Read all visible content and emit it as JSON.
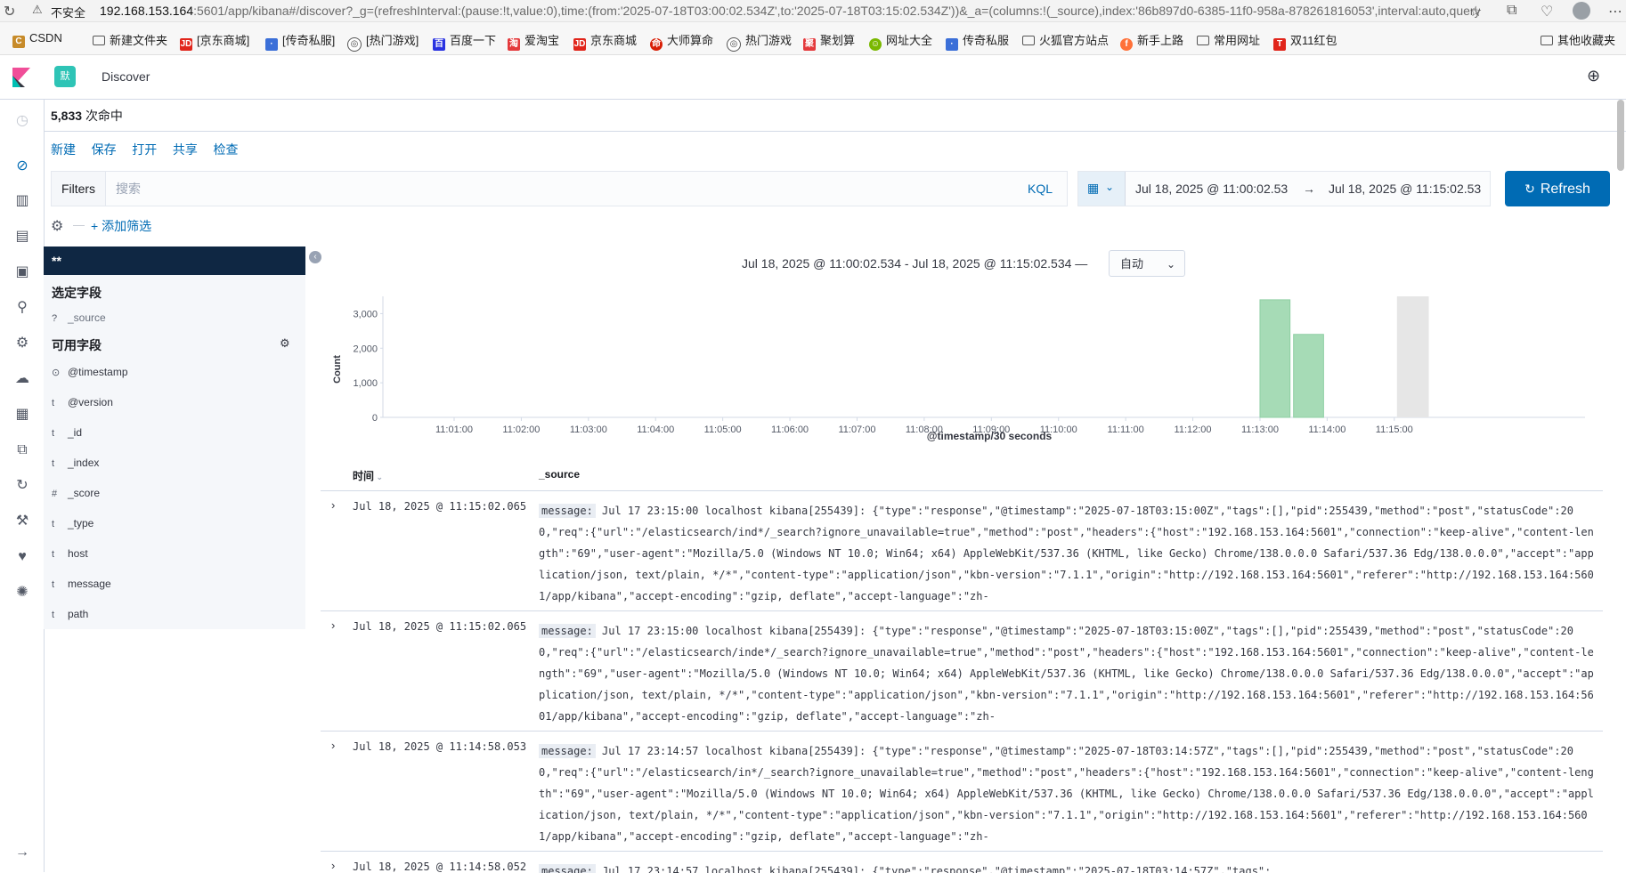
{
  "browser": {
    "security": "不安全",
    "url_host": "192.168.153.164",
    "url_rest": ":5601/app/kibana#/discover?_g=(refreshInterval:(pause:!t,value:0),time:(from:'2025-07-18T03:00:02.534Z',to:'2025-07-18T03:15:02.534Z'))&_a=(columns:!(_source),index:'86b897d0-6385-11f0-958a-878261816053',interval:auto,query:...",
    "bookmarks": [
      "CSDN",
      "新建文件夹",
      "[京东商城]",
      "[传奇私服]",
      "[热门游戏]",
      "百度一下",
      "爱淘宝",
      "京东商城",
      "大师算命",
      "热门游戏",
      "聚划算",
      "网址大全",
      "传奇私服",
      "火狐官方站点",
      "新手上路",
      "常用网址",
      "双11红包",
      "其他收藏夹"
    ]
  },
  "header": {
    "space_initial": "默",
    "app_title": "Discover"
  },
  "hits": {
    "count": "5,833",
    "suffix": "次命中"
  },
  "top_menu": [
    "新建",
    "保存",
    "打开",
    "共享",
    "检查"
  ],
  "search": {
    "filters_label": "Filters",
    "placeholder": "搜索",
    "kql_label": "KQL"
  },
  "time": {
    "start": "Jul 18, 2025 @ 11:00:02.53",
    "arrow": "→",
    "end": "Jul 18, 2025 @ 11:15:02.53",
    "refresh_label": "Refresh"
  },
  "filter_row": {
    "add_filter": "+ 添加筛选"
  },
  "sidebar": {
    "index_pattern": "**",
    "selected_title": "选定字段",
    "selected_fields": [
      {
        "type": "?",
        "name": "_source"
      }
    ],
    "available_title": "可用字段",
    "available_fields": [
      {
        "type": "⊙",
        "name": "@timestamp"
      },
      {
        "type": "t",
        "name": "@version"
      },
      {
        "type": "t",
        "name": "_id"
      },
      {
        "type": "t",
        "name": "_index"
      },
      {
        "type": "#",
        "name": "_score"
      },
      {
        "type": "t",
        "name": "_type"
      },
      {
        "type": "t",
        "name": "host"
      },
      {
        "type": "t",
        "name": "message"
      },
      {
        "type": "t",
        "name": "path"
      }
    ]
  },
  "chart_header": {
    "range": "Jul 18, 2025 @ 11:00:02.534 - Jul 18, 2025 @ 11:15:02.534 —",
    "interval": "自动"
  },
  "chart_data": {
    "type": "bar",
    "categories": [
      "11:01:00",
      "11:02:00",
      "11:03:00",
      "11:04:00",
      "11:05:00",
      "11:06:00",
      "11:07:00",
      "11:08:00",
      "11:09:00",
      "11:10:00",
      "11:11:00",
      "11:12:00",
      "11:13:00",
      "11:14:00",
      "11:15:00"
    ],
    "bars": [
      {
        "x": "11:13:00",
        "value": 3400
      },
      {
        "x": "11:13:30",
        "value": 2400
      }
    ],
    "partial_bucket": {
      "x": "11:15:00",
      "value": 3500
    },
    "yticks": [
      0,
      1000,
      2000,
      3000
    ],
    "ytick_labels": [
      "0",
      "1,000",
      "2,000",
      "3,000"
    ],
    "ylim": [
      0,
      3500
    ],
    "ylabel": "Count",
    "xlabel": "@timestamp/30 seconds",
    "bar_color": "#a6dbb6"
  },
  "table": {
    "col_time": "时间",
    "col_source": "_source",
    "rows": [
      {
        "time": "Jul 18, 2025 @ 11:15:02.065",
        "label": "message:",
        "text": " Jul 17 23:15:00 localhost kibana[255439]: {\"type\":\"response\",\"@timestamp\":\"2025-07-18T03:15:00Z\",\"tags\":[],\"pid\":255439,\"method\":\"post\",\"statusCode\":200,\"req\":{\"url\":\"/elasticsearch/ind*/_search?ignore_unavailable=true\",\"method\":\"post\",\"headers\":{\"host\":\"192.168.153.164:5601\",\"connection\":\"keep-alive\",\"content-length\":\"69\",\"user-agent\":\"Mozilla/5.0 (Windows NT 10.0; Win64; x64) AppleWebKit/537.36 (KHTML, like Gecko) Chrome/138.0.0.0 Safari/537.36 Edg/138.0.0.0\",\"accept\":\"application/json, text/plain, */*\",\"content-type\":\"application/json\",\"kbn-version\":\"7.1.1\",\"origin\":\"http://192.168.153.164:5601\",\"referer\":\"http://192.168.153.164:5601/app/kibana\",\"accept-encoding\":\"gzip, deflate\",\"accept-language\":\"zh-"
      },
      {
        "time": "Jul 18, 2025 @ 11:15:02.065",
        "label": "message:",
        "text": " Jul 17 23:15:00 localhost kibana[255439]: {\"type\":\"response\",\"@timestamp\":\"2025-07-18T03:15:00Z\",\"tags\":[],\"pid\":255439,\"method\":\"post\",\"statusCode\":200,\"req\":{\"url\":\"/elasticsearch/inde*/_search?ignore_unavailable=true\",\"method\":\"post\",\"headers\":{\"host\":\"192.168.153.164:5601\",\"connection\":\"keep-alive\",\"content-length\":\"69\",\"user-agent\":\"Mozilla/5.0 (Windows NT 10.0; Win64; x64) AppleWebKit/537.36 (KHTML, like Gecko) Chrome/138.0.0.0 Safari/537.36 Edg/138.0.0.0\",\"accept\":\"application/json, text/plain, */*\",\"content-type\":\"application/json\",\"kbn-version\":\"7.1.1\",\"origin\":\"http://192.168.153.164:5601\",\"referer\":\"http://192.168.153.164:5601/app/kibana\",\"accept-encoding\":\"gzip, deflate\",\"accept-language\":\"zh-"
      },
      {
        "time": "Jul 18, 2025 @ 11:14:58.053",
        "label": "message:",
        "text": " Jul 17 23:14:57 localhost kibana[255439]: {\"type\":\"response\",\"@timestamp\":\"2025-07-18T03:14:57Z\",\"tags\":[],\"pid\":255439,\"method\":\"post\",\"statusCode\":200,\"req\":{\"url\":\"/elasticsearch/in*/_search?ignore_unavailable=true\",\"method\":\"post\",\"headers\":{\"host\":\"192.168.153.164:5601\",\"connection\":\"keep-alive\",\"content-length\":\"69\",\"user-agent\":\"Mozilla/5.0 (Windows NT 10.0; Win64; x64) AppleWebKit/537.36 (KHTML, like Gecko) Chrome/138.0.0.0 Safari/537.36 Edg/138.0.0.0\",\"accept\":\"application/json, text/plain, */*\",\"content-type\":\"application/json\",\"kbn-version\":\"7.1.1\",\"origin\":\"http://192.168.153.164:5601\",\"referer\":\"http://192.168.153.164:5601/app/kibana\",\"accept-encoding\":\"gzip, deflate\",\"accept-language\":\"zh-"
      },
      {
        "time": "Jul 18, 2025 @ 11:14:58.052",
        "label": "message:",
        "text": " Jul 17 23:14:57 localhost kibana[255439]: {\"type\":\"response\",\"@timestamp\":\"2025-07-18T03:14:57Z\",\"tags\":"
      }
    ]
  },
  "colors": {
    "accent": "#006bb4",
    "index_bar": "#0f2743",
    "space": "#2ec4b6"
  }
}
